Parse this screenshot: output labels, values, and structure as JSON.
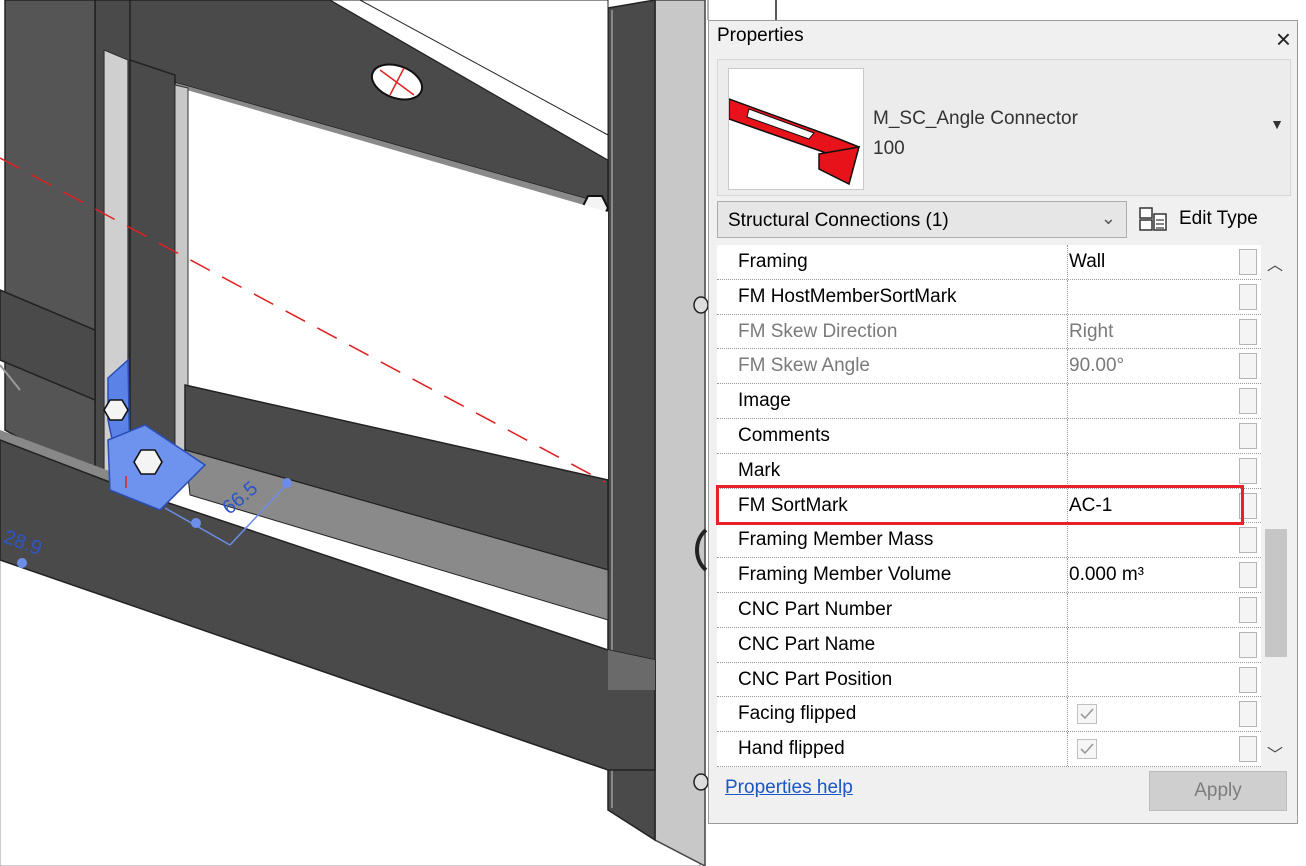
{
  "panel": {
    "title": "Properties",
    "close_label": "×",
    "type_selector": {
      "family": "M_SC_Angle Connector",
      "type": "100"
    },
    "category_filter": "Structural Connections (1)",
    "edit_type_label": "Edit Type",
    "parameters": [
      {
        "name": "Framing",
        "value": "Wall",
        "greyed": false
      },
      {
        "name": "FM HostMemberSortMark",
        "value": "",
        "greyed": false
      },
      {
        "name": "FM Skew Direction",
        "value": "Right",
        "greyed": true
      },
      {
        "name": "FM Skew Angle",
        "value": "90.00°",
        "greyed": true
      },
      {
        "name": "Image",
        "value": "",
        "greyed": false
      },
      {
        "name": "Comments",
        "value": "",
        "greyed": false
      },
      {
        "name": "Mark",
        "value": "",
        "greyed": false
      },
      {
        "name": "FM SortMark",
        "value": "AC-1",
        "greyed": false
      },
      {
        "name": "Framing Member Mass",
        "value": "",
        "greyed": false
      },
      {
        "name": "Framing Member Volume",
        "value": "0.000 m³",
        "greyed": false
      },
      {
        "name": "CNC Part Number",
        "value": "",
        "greyed": false
      },
      {
        "name": "CNC Part Name",
        "value": "",
        "greyed": false
      },
      {
        "name": "CNC Part Position",
        "value": "",
        "greyed": false
      },
      {
        "name": "Facing flipped",
        "checked": true,
        "greyed": false
      },
      {
        "name": "Hand flipped",
        "checked": true,
        "greyed": false
      }
    ],
    "help_link": "Properties help",
    "apply_label": "Apply"
  },
  "viewport": {
    "dimensions": [
      "66.5",
      "28.9"
    ]
  },
  "colors": {
    "highlight": "#e8202a",
    "connector_selected": "#5b82e6",
    "reference_line": "#e02020",
    "link": "#1a56c5"
  }
}
